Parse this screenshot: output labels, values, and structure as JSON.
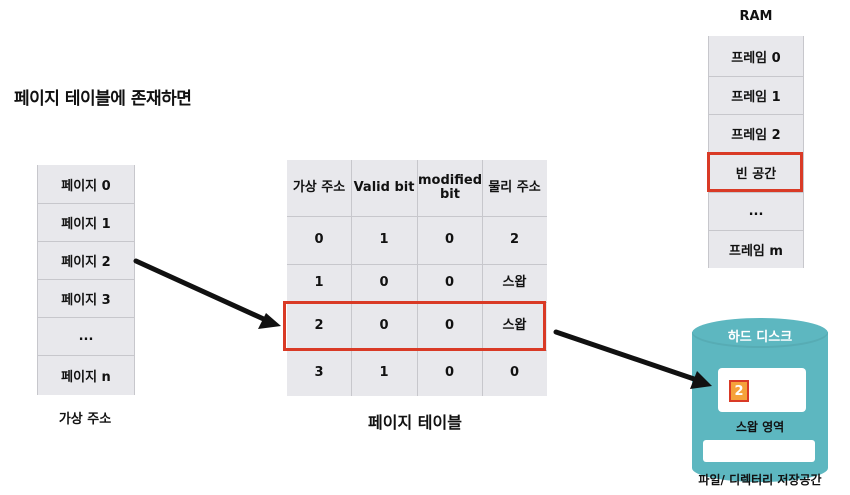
{
  "title": "페이지 테이블에 존재하면",
  "virtual_pages": {
    "items": [
      "페이지 0",
      "페이지 1",
      "페이지 2",
      "페이지 3",
      "...",
      "페이지 n"
    ],
    "caption": "가상 주소"
  },
  "page_table": {
    "headers": [
      "가상 주소",
      "Valid bit",
      "modified bit",
      "물리 주소"
    ],
    "rows": [
      [
        "0",
        "1",
        "0",
        "2"
      ],
      [
        "1",
        "0",
        "0",
        "스왑"
      ],
      [
        "2",
        "0",
        "0",
        "스왑"
      ],
      [
        "3",
        "1",
        "0",
        "0"
      ]
    ],
    "caption": "페이지 테이블",
    "highlight_row_index": 2
  },
  "ram": {
    "title": "RAM",
    "frames": [
      "프레임 0",
      "프레임 1",
      "프레임 2",
      "빈 공간",
      "...",
      "프레임 m"
    ],
    "highlight_frame_index": 3
  },
  "disk": {
    "label": "하드 디스크",
    "swap_badge": "2",
    "swap_label": "스왑 영역",
    "file_label": "파일/ 디렉터리 저장공간"
  },
  "colors": {
    "highlight": "#d93a26",
    "cell_bg": "#e8e8ec",
    "disk": "#5db7c0",
    "badge": "#f5a23a"
  }
}
